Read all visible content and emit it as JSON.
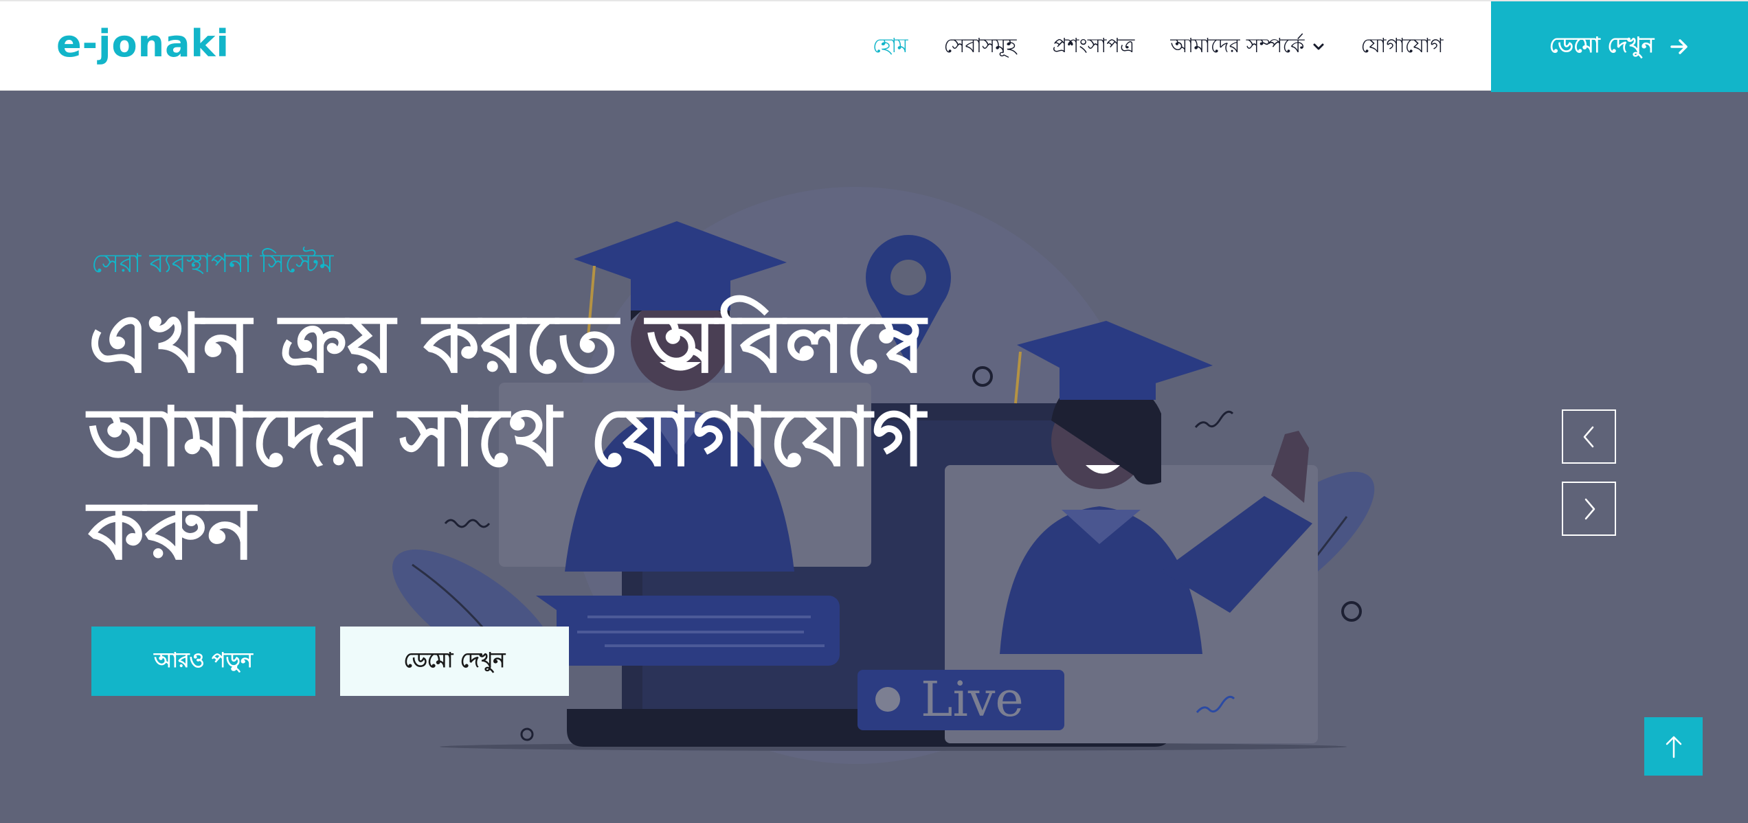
{
  "header": {
    "logo": "e-jonaki",
    "nav": [
      {
        "label": "হোম"
      },
      {
        "label": "সেবাসমূহ"
      },
      {
        "label": "প্রশংসাপত্র"
      },
      {
        "label": "আমাদের সম্পর্কে"
      },
      {
        "label": "যোগাযোগ"
      }
    ],
    "demo_button": "ডেমো দেখুন"
  },
  "hero": {
    "kicker": "সেরা ব্যবস্থাপনা সিস্টেম",
    "headline": "এখন ক্রয় করতে অবিলম্বে আমাদের সাথে যোগাযোগ করুন",
    "primary_button": "আরও পড়ুন",
    "secondary_button": "ডেমো দেখুন",
    "live_badge": "Live"
  },
  "colors": {
    "accent": "#12b5c9",
    "hero_bg": "#5f6378",
    "nav_text": "#161a2b"
  },
  "icons": {
    "nav_dropdown": "chevron-down-icon",
    "demo_arrow": "arrow-right-icon",
    "prev": "chevron-left-icon",
    "next": "chevron-right-icon",
    "scroll_top": "arrow-up-icon"
  }
}
